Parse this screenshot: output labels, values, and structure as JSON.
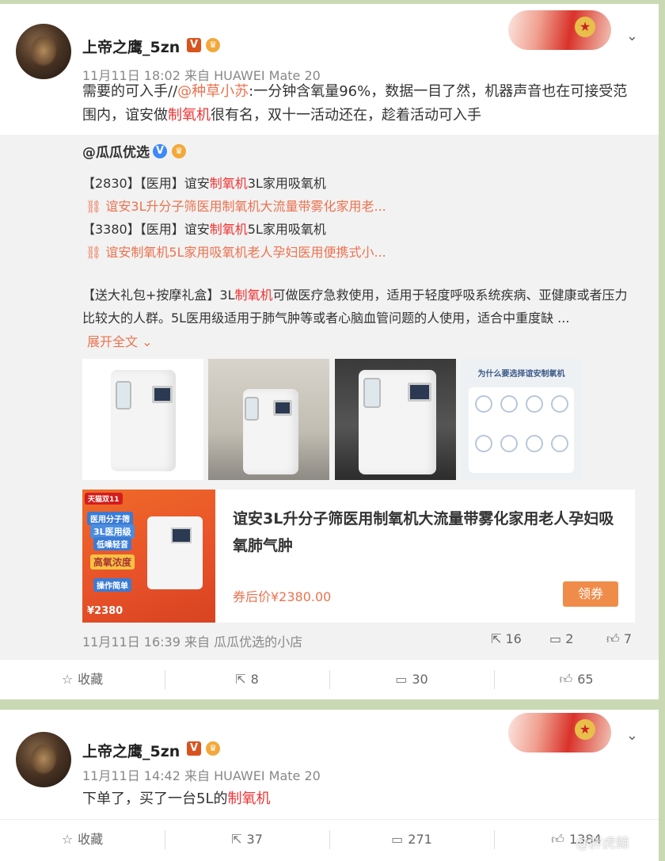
{
  "post1": {
    "username": "上帝之鹰_5zn",
    "meta": "11月11日 18:02 来自 HUAWEI Mate 20",
    "text_pre": "需要的可入手//",
    "mention": "@种草小苏",
    "text_mid": ":一分钟含氧量96%，数据一目了然，机器声音也在可接受范围内，谊安做",
    "keyword": "制氧机",
    "text_post": "很有名，双十一活动还在，趁着活动可入手",
    "repost": {
      "username": "@瓜瓜优选",
      "line1_pre": "【2830】【医用】谊安",
      "line1_key": "制氧机",
      "line1_post": "3L家用吸氧机",
      "link1": "谊安3L升分子筛医用制氧机大流量带雾化家用老...",
      "line2_pre": "【3380】【医用】谊安",
      "line2_key": "制氧机",
      "line2_post": "5L家用吸氧机",
      "link2": "谊安制氧机5L家用吸氧机老人孕妇医用便携式小...",
      "body_pre": "【送大礼包+按摩礼盒】3L",
      "body_key": "制氧机",
      "body_post": "可做医疗急救使用，适用于轻度呼吸系统疾病、亚健康或者压力比较大的人群。5L医用级适用于肺气肿等或者心脑血管问题的人使用，适合中重度缺 ...",
      "expand": "展开全文",
      "photo4_title": "为什么要选择谊安制氧机",
      "product": {
        "title": "谊安3L升分子筛医用制氧机大流量带雾化家用老人孕妇吸氧肺气肿",
        "price": "券后价¥2380.00",
        "coupon": "领券",
        "img_top": "天猫双11",
        "img_tag1": "医用分子筛",
        "img_tag2": "3L医用级",
        "img_tag3": "低噪轻音",
        "img_tag4": "高氧浓度",
        "img_tag5": "操作简单",
        "img_price": "¥2380"
      },
      "footer_meta": "11月11日 16:39 来自 瓜瓜优选的小店",
      "shares": "16",
      "comments": "2",
      "likes": "7"
    },
    "actions": {
      "favorite": "收藏",
      "shares": "8",
      "comments": "30",
      "likes": "65"
    }
  },
  "post2": {
    "username": "上帝之鹰_5zn",
    "meta": "11月11日 14:42 来自 HUAWEI Mate 20",
    "text_pre": "下单了，买了一台5L的",
    "keyword": "制氧机",
    "actions": {
      "favorite": "收藏",
      "shares": "37",
      "comments": "271",
      "likes": "1384"
    }
  },
  "watermark": "@胖虎鲸",
  "colors": {
    "page_bg": "#c9d9b4",
    "link": "#eb7350",
    "keyword": "#e33333",
    "repost_bg": "#f2f2f2",
    "coupon": "#f08c4a"
  }
}
